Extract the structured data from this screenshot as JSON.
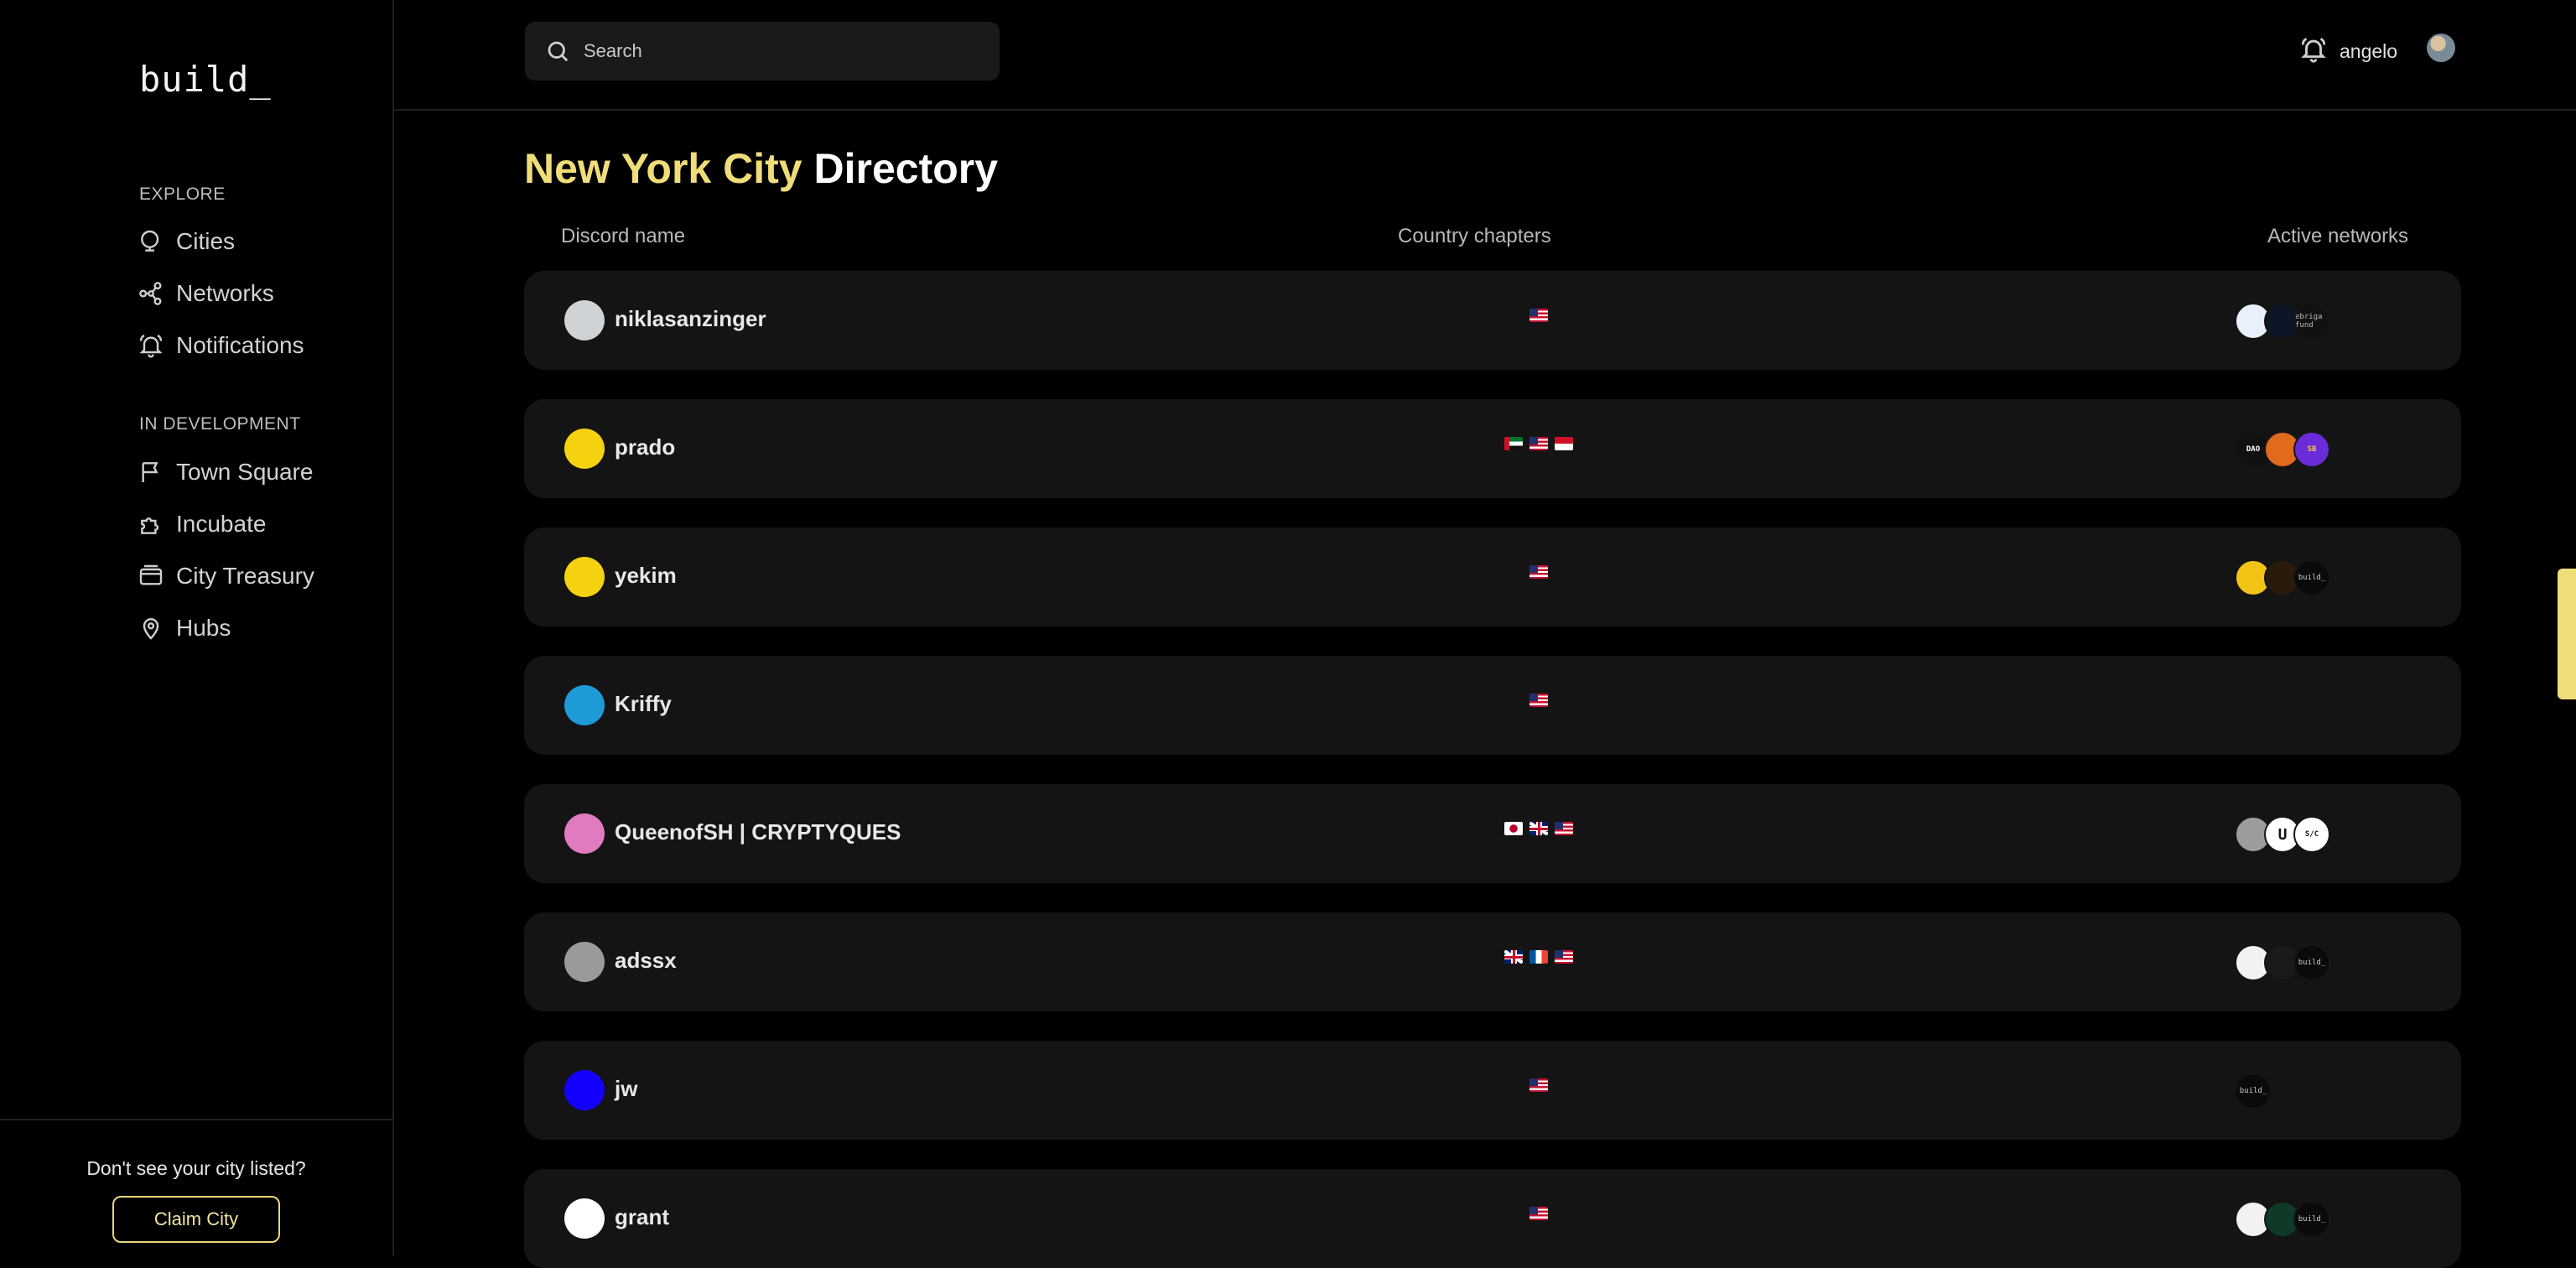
{
  "sidebar": {
    "logo": "build_",
    "explore_label": "EXPLORE",
    "explore_items": [
      {
        "label": "Cities",
        "icon": "globe-icon"
      },
      {
        "label": "Networks",
        "icon": "network-icon"
      },
      {
        "label": "Notifications",
        "icon": "bell-icon"
      }
    ],
    "dev_label": "IN DEVELOPMENT",
    "dev_items": [
      {
        "label": "Town Square",
        "icon": "flag-icon"
      },
      {
        "label": "Incubate",
        "icon": "puzzle-icon"
      },
      {
        "label": "City Treasury",
        "icon": "wallet-icon"
      },
      {
        "label": "Hubs",
        "icon": "map-pin-icon"
      }
    ],
    "footer_text": "Don't see your city listed?",
    "claim_label": "Claim City"
  },
  "topbar": {
    "search_placeholder": "Search",
    "username": "angelo"
  },
  "page": {
    "title_city": "New York City",
    "title_rest": "Directory"
  },
  "table": {
    "columns": [
      "Discord name",
      "Country chapters",
      "Active networks"
    ],
    "rows": [
      {
        "name": "niklasanzinger",
        "flags": [
          "us"
        ],
        "networks": [
          "snowflake",
          "chevron",
          "fund"
        ],
        "avatar_color": "#cfd3d6"
      },
      {
        "name": "prado",
        "flags": [
          "ae",
          "us",
          "id"
        ],
        "networks": [
          "dao",
          "lion",
          "sb"
        ],
        "avatar_color": "#f5d20f"
      },
      {
        "name": "yekim",
        "flags": [
          "us"
        ],
        "networks": [
          "bars",
          "tiger",
          "build"
        ],
        "avatar_color": "#f5d20f"
      },
      {
        "name": "Kriffy",
        "flags": [
          "us"
        ],
        "networks": [],
        "avatar_color": "#1e9bd7"
      },
      {
        "name": "QueenofSH | CRYPTYQUES",
        "flags": [
          "jp",
          "gb",
          "us"
        ],
        "networks": [
          "grey",
          "u",
          "sc"
        ],
        "avatar_color": "#e07bc0"
      },
      {
        "name": "adssx",
        "flags": [
          "gb",
          "fr",
          "us"
        ],
        "networks": [
          "integral",
          "feather",
          "build"
        ],
        "avatar_color": "#9a9a9a"
      },
      {
        "name": "jw",
        "flags": [
          "us"
        ],
        "networks": [
          "build"
        ],
        "avatar_color": "#1400ff"
      },
      {
        "name": "grant",
        "flags": [
          "us"
        ],
        "networks": [
          "integral",
          "green",
          "build"
        ],
        "avatar_color": "#ffffff"
      }
    ]
  },
  "network_text": {
    "fund": "ebriga fund",
    "dao": "DAO",
    "sb": "SB",
    "u": "U",
    "sc": "S/C",
    "build": "build_"
  }
}
